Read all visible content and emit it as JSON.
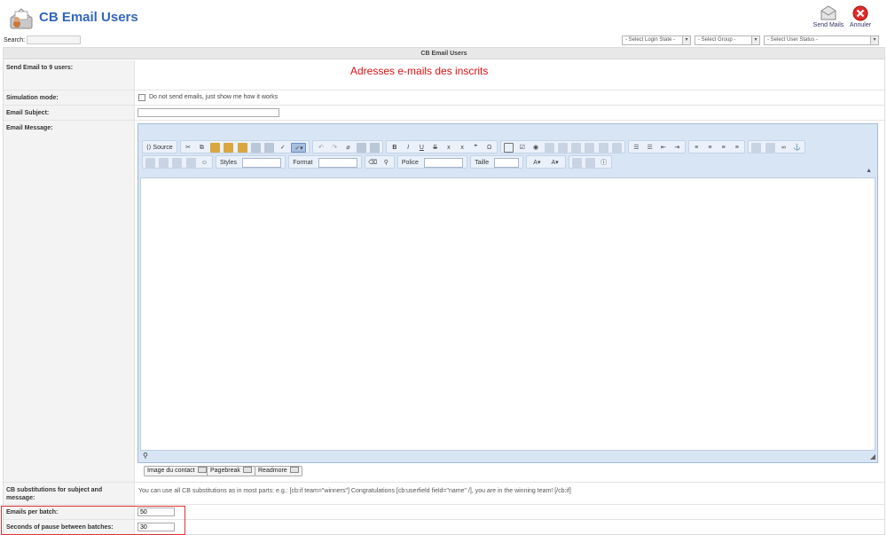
{
  "header": {
    "title": "CB Email Users",
    "logo_icon": "email-users-logo-icon",
    "send_label": "Send Mails",
    "cancel_label": "Annuler"
  },
  "search": {
    "label": "Search:",
    "value": ""
  },
  "filters": {
    "login_state": "- Select Login State -",
    "group": "- Select Group -",
    "user_status": "- Select User Status -"
  },
  "form": {
    "heading": "CB Email Users",
    "send_to_label": "Send Email to 9 users:",
    "recipients_placeholder": "Adresses e-mails des inscrits",
    "simulation_label": "Simulation mode:",
    "simulation_checkbox_label": "Do not send emails, just show me how it works",
    "subject_label": "Email Subject:",
    "subject_value": "",
    "message_label": "Email Message:",
    "substitutions_label": "CB substitutions for subject and message:",
    "substitutions_text": "You can use all CB substitutions as in most parts: e.g.: [cb:if team=\"winners\"] Congratulations [cb:userfield field=\"name\" /], you are in the winning team! [/cb:if]",
    "batch_label": "Emails per batch:",
    "batch_value": "50",
    "pause_label": "Seconds of pause between batches:",
    "pause_value": "30"
  },
  "editor": {
    "source_label": "Source",
    "styles_label": "Styles",
    "format_label": "Format",
    "font_label": "Police",
    "size_label": "Taille",
    "bold": "B",
    "italic": "I",
    "underline": "U",
    "strike": "S",
    "subscript": "x",
    "superscript": "x",
    "omega": "Ω",
    "quote": "❞",
    "extra_buttons": [
      "Image du contact",
      "Pagebreak",
      "Readmore"
    ]
  },
  "colors": {
    "title_blue": "#3366bb",
    "hint_red": "#dd1111",
    "highlight_red": "#dd3333",
    "editor_bg": "#d7e5f5"
  }
}
